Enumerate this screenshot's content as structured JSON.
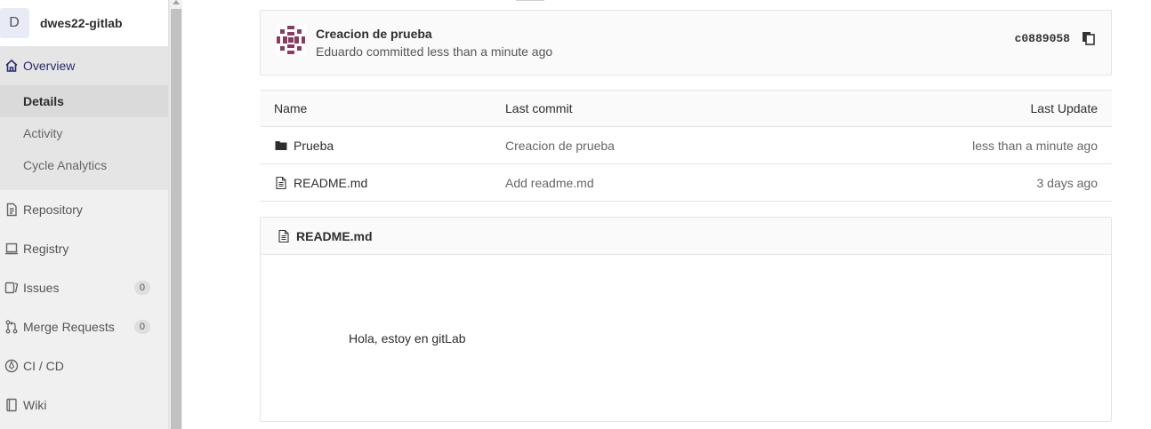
{
  "sidebar": {
    "project_initial": "D",
    "project_name": "dwes22-gitlab",
    "overview_label": "Overview",
    "sub_items": [
      {
        "label": "Details",
        "active": true
      },
      {
        "label": "Activity",
        "active": false
      },
      {
        "label": "Cycle Analytics",
        "active": false
      }
    ],
    "items": [
      {
        "label": "Repository",
        "icon": "doc-icon"
      },
      {
        "label": "Registry",
        "icon": "laptop-icon"
      },
      {
        "label": "Issues",
        "icon": "issues-icon",
        "badge": "0"
      },
      {
        "label": "Merge Requests",
        "icon": "merge-request-icon",
        "badge": "0"
      },
      {
        "label": "CI / CD",
        "icon": "rocket-icon"
      },
      {
        "label": "Wiki",
        "icon": "book-icon"
      }
    ]
  },
  "commit": {
    "title": "Creacion de prueba",
    "meta": "Eduardo committed less than a minute ago",
    "sha": "c0889058"
  },
  "tree": {
    "headers": {
      "name": "Name",
      "last_commit": "Last commit",
      "last_update": "Last Update"
    },
    "rows": [
      {
        "name": "Prueba",
        "type": "folder",
        "commit": "Creacion de prueba",
        "updated": "less than a minute ago"
      },
      {
        "name": "README.md",
        "type": "file",
        "commit": "Add readme.md",
        "updated": "3 days ago"
      }
    ]
  },
  "readme": {
    "filename": "README.md",
    "content": "Hola, estoy en gitLab"
  },
  "colors": {
    "sidebar_bg": "#f0f0f0",
    "active_nav": "#2a2a6e",
    "avatar_accent": "#8b3a62"
  }
}
